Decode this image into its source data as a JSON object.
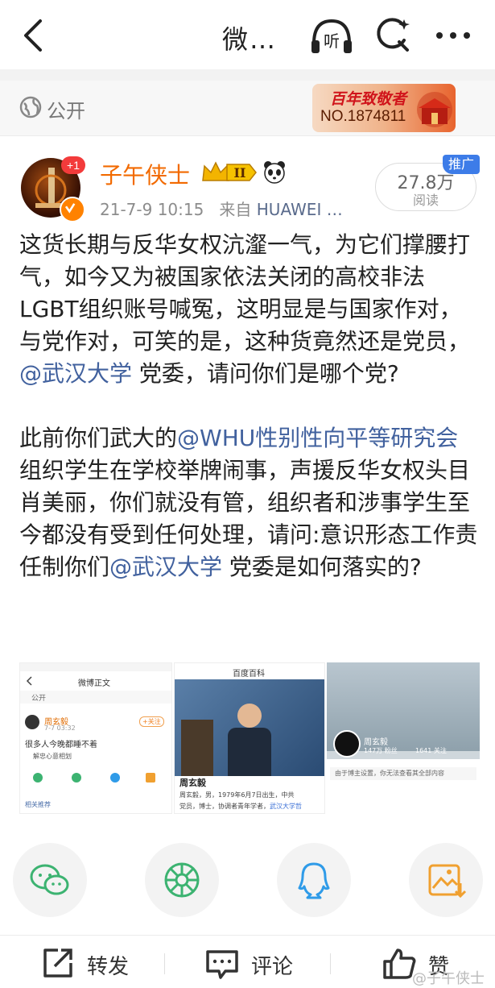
{
  "header": {
    "title": "微…"
  },
  "visibility": {
    "label": "公开"
  },
  "badge": {
    "title": "百年致敬者",
    "number": "NO.1874811"
  },
  "post": {
    "plus_badge": "+1",
    "username": "子午侠士",
    "level": "II",
    "time": "21-7-9 10:15",
    "source_prefix": "来自",
    "source": "HUAWEI …",
    "read_count": "27.8万",
    "read_label": "阅读",
    "promo_tag": "推广",
    "p1_a": "这货长期与反华女权沆瀣一气，为它们撑腰打气，如今又为被国家依法关闭的高校非法LGBT组织账号喊冤，这明显是与国家作对，与党作对，可笑的是，这种货竟然还是党员，",
    "p1_mention": "@武汉大学",
    "p1_b": " 党委，请问你们是哪个党?",
    "p2_a": "此前你们武大的",
    "p2_mention1": "@WHU性别性向平等研究会",
    "p2_b": " 组织学生在学校举牌闹事，声援反华女权头目肖美丽，你们就没有管，组织者和涉事学生至今都没有受到任何处理，请问:意识形态工作责任制你们",
    "p2_mention2": "@武汉大学",
    "p2_c": " 党委是如何落实的?"
  },
  "thumbs": {
    "t1": {
      "title": "微博正文",
      "public": "公开",
      "name": "周玄毅",
      "date": "7-7 03:32",
      "text": "很多人今晚都睡不着",
      "follow": "+关注",
      "related": "相关推荐",
      "loc": "解忠心意相划"
    },
    "t2": {
      "title": "百度百科",
      "name": "周玄毅",
      "desc1": "周玄毅，男，1979年6月7日出生，中共",
      "desc2": "党员，博士，协调者青年学者，",
      "link": "武汉大学哲"
    },
    "t3": {
      "name": "周玄毅",
      "stats1": "147万 粉丝",
      "stats2": "1641 关注",
      "notice": "由于博主设置，你无法查看其全部内容"
    }
  },
  "share_targets": [
    "wechat-icon",
    "moments-icon",
    "qq-icon",
    "save-image-icon"
  ],
  "actions": {
    "repost": "转发",
    "comment": "评论",
    "like": "赞"
  },
  "watermark": "@子午侠士",
  "colors": {
    "orange": "#f26a00",
    "mention": "#41619e",
    "promo": "#3d7ce8",
    "green": "#3cb371"
  }
}
